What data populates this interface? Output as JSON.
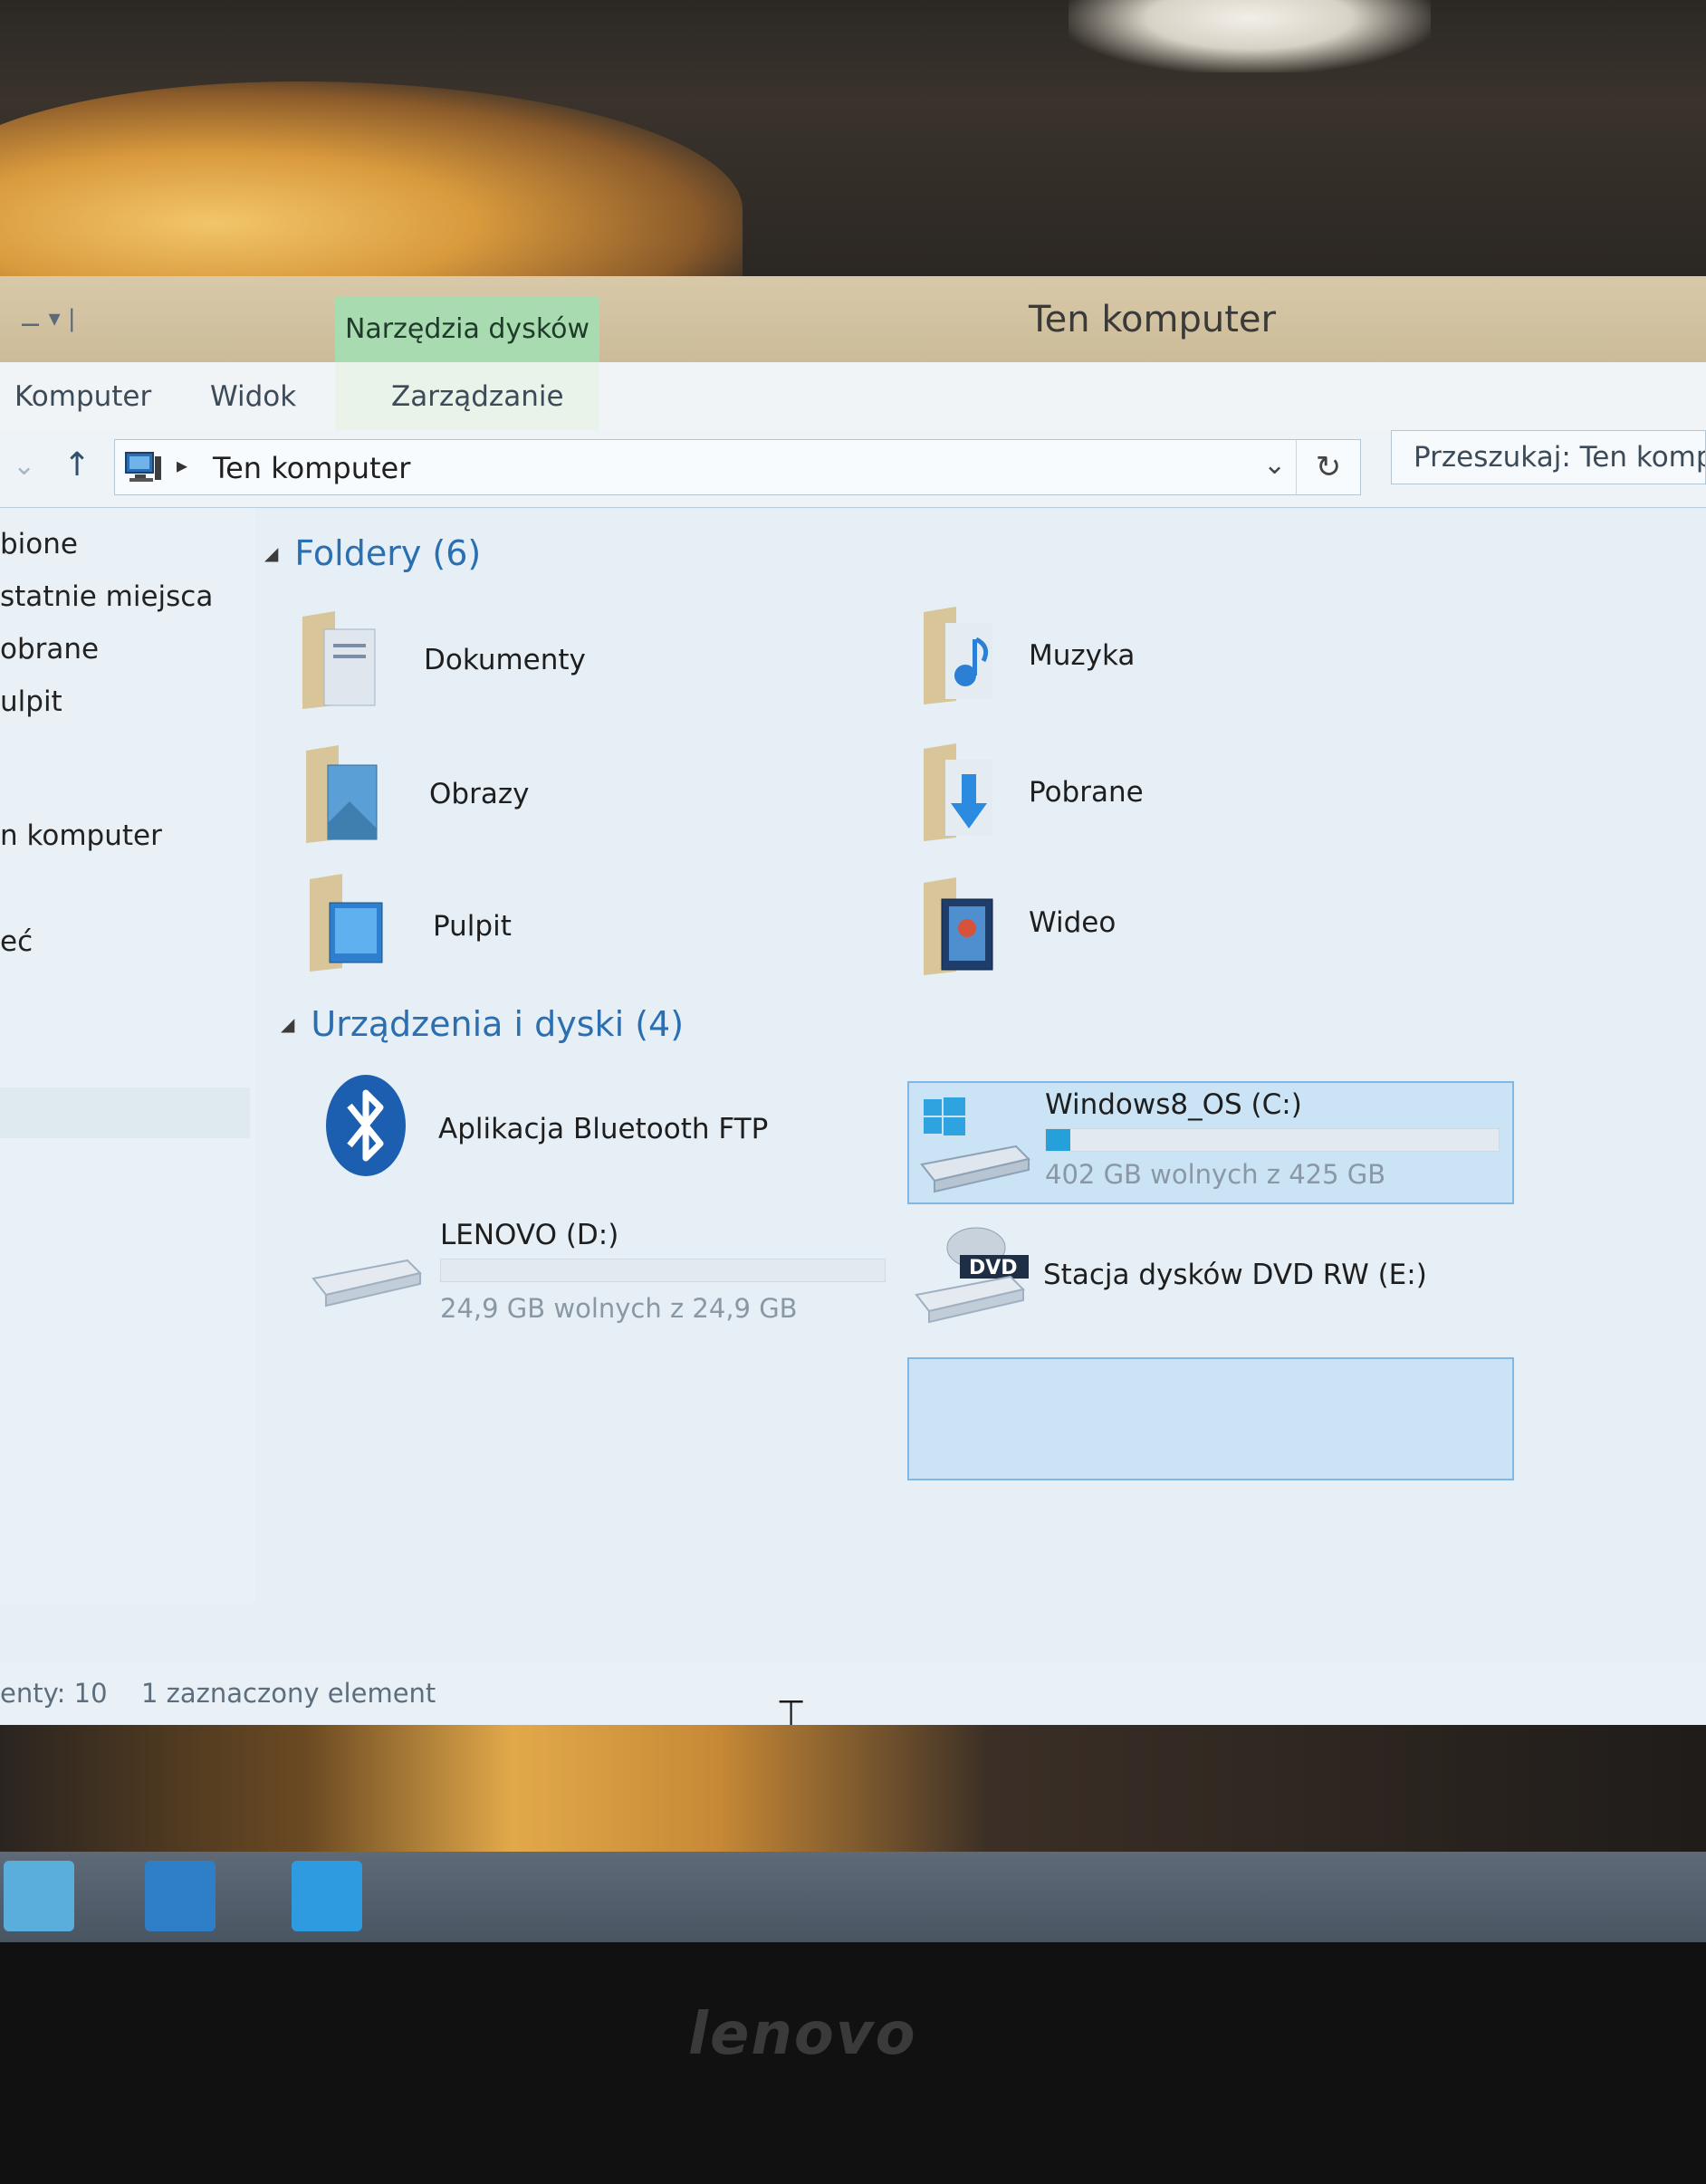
{
  "window": {
    "title": "Ten komputer",
    "tools_tab": "Narzędzia dysków",
    "qat": "⚊ ▾ |"
  },
  "ribbon": {
    "tabs": [
      "Komputer",
      "Widok",
      "Zarządzanie"
    ]
  },
  "address": {
    "crumb": "Ten komputer",
    "search_placeholder": "Przeszukaj: Ten komp"
  },
  "navpane": {
    "items": [
      "bione",
      "statnie miejsca",
      "obrane",
      "ulpit",
      "n komputer",
      "eć"
    ]
  },
  "folders": {
    "header": "Foldery (6)",
    "items": [
      "Dokumenty",
      "Muzyka",
      "Obrazy",
      "Pobrane",
      "Pulpit",
      "Wideo"
    ]
  },
  "devices": {
    "header": "Urządzenia i dyski (4)",
    "bluetooth": "Aplikacja Bluetooth FTP",
    "c_drive": {
      "name": "Windows8_OS (C:)",
      "info": "402 GB wolnych z 425 GB",
      "used_fraction": 0.054
    },
    "d_drive": {
      "name": "LENOVO (D:)",
      "info": "24,9 GB wolnych z 24,9 GB",
      "used_fraction": 0.0
    },
    "dvd": {
      "name": "Stacja dysków DVD RW (E:)",
      "badge": "DVD"
    }
  },
  "status": {
    "count": "enty: 10",
    "selected": "1 zaznaczony element"
  },
  "bezel": {
    "brand": "lenovo"
  },
  "colors": {
    "accent": "#2a6fb1",
    "tools_tab": "#a8dcb0",
    "drive_fill": "#26a0da"
  }
}
